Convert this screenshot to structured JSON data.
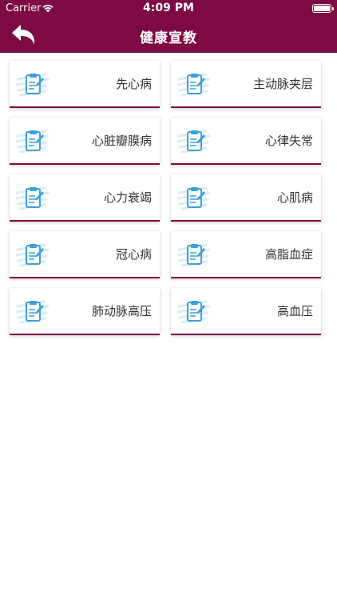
{
  "status_bar": {
    "carrier": "Carrier",
    "time": "4:09 PM"
  },
  "nav": {
    "title": "健康宣教",
    "back_icon": "back-arrow-icon"
  },
  "topics": [
    {
      "label": "先心病",
      "icon": "clipboard-icon"
    },
    {
      "label": "主动脉夹层",
      "icon": "clipboard-icon"
    },
    {
      "label": "心脏瓣膜病",
      "icon": "clipboard-icon"
    },
    {
      "label": "心律失常",
      "icon": "clipboard-icon"
    },
    {
      "label": "心力衰竭",
      "icon": "clipboard-icon"
    },
    {
      "label": "心肌病",
      "icon": "clipboard-icon"
    },
    {
      "label": "冠心病",
      "icon": "clipboard-icon"
    },
    {
      "label": "高脂血症",
      "icon": "clipboard-icon"
    },
    {
      "label": "肺动脉高压",
      "icon": "clipboard-icon"
    },
    {
      "label": "高血压",
      "icon": "clipboard-icon"
    }
  ],
  "colors": {
    "brand": "#7d0a43",
    "icon_blue": "#3aa0d8",
    "icon_light": "#d8ecf8"
  }
}
